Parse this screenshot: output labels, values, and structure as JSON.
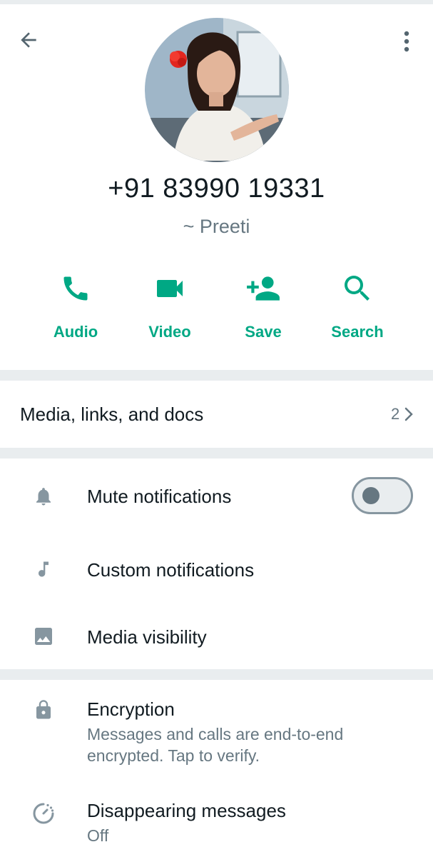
{
  "contact": {
    "phone": "+91 83990 19331",
    "name": "~ Preeti"
  },
  "actions": [
    {
      "label": "Audio",
      "icon": "phone-icon"
    },
    {
      "label": "Video",
      "icon": "video-icon"
    },
    {
      "label": "Save",
      "icon": "add-contact-icon"
    },
    {
      "label": "Search",
      "icon": "search-icon"
    }
  ],
  "media": {
    "label": "Media, links, and docs",
    "count": "2"
  },
  "settings": {
    "mute": {
      "label": "Mute notifications",
      "enabled": false
    },
    "custom": {
      "label": "Custom notifications"
    },
    "visibility": {
      "label": "Media visibility"
    }
  },
  "security": {
    "encryption": {
      "title": "Encryption",
      "line1": "Messages and calls are end-to-end",
      "line2": "encrypted. Tap to verify."
    },
    "disappearing": {
      "title": "Disappearing messages",
      "value": "Off"
    }
  },
  "colors": {
    "accent": "#00a884",
    "text_primary": "#111b21",
    "text_secondary": "#667781",
    "divider": "#e9edef"
  }
}
